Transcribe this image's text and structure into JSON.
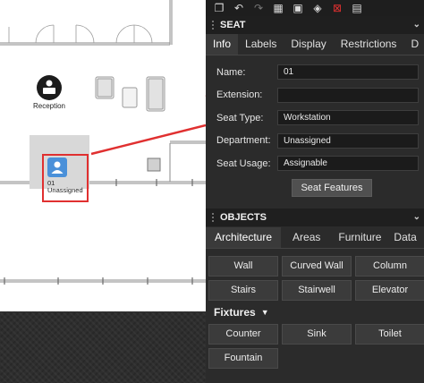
{
  "canvas": {
    "reception_label": "Reception",
    "seat": {
      "name": "01",
      "status": "Unassigned"
    }
  },
  "toolbar": {
    "icons": [
      "copy-icon",
      "undo-icon",
      "redo-icon",
      "hatch-icon",
      "select-frame-icon",
      "layers-icon",
      "delete-area-icon",
      "trash-icon"
    ]
  },
  "seat_panel": {
    "title": "SEAT",
    "tabs": [
      "Info",
      "Labels",
      "Display",
      "Restrictions",
      "D"
    ],
    "active_tab": "Info",
    "fields": [
      {
        "label": "Name:",
        "value": "01"
      },
      {
        "label": "Extension:",
        "value": ""
      },
      {
        "label": "Seat Type:",
        "value": "Workstation"
      },
      {
        "label": "Department:",
        "value": "Unassigned"
      },
      {
        "label": "Seat Usage:",
        "value": "Assignable"
      }
    ],
    "features_button": "Seat Features"
  },
  "objects_panel": {
    "title": "OBJECTS",
    "tabs": [
      "Architecture",
      "Areas",
      "Furniture",
      "Data"
    ],
    "active_tab": "Architecture",
    "architecture_buttons": [
      "Wall",
      "Curved Wall",
      "Column",
      "Stairs",
      "Stairwell",
      "Elevator"
    ],
    "fixtures_label": "Fixtures",
    "fixtures_buttons": [
      "Counter",
      "Sink",
      "Toilet",
      "Fountain"
    ]
  },
  "colors": {
    "highlight": "#e03030",
    "seat_icon": "#4a90d9",
    "panel_bg": "#2b2b2b"
  }
}
